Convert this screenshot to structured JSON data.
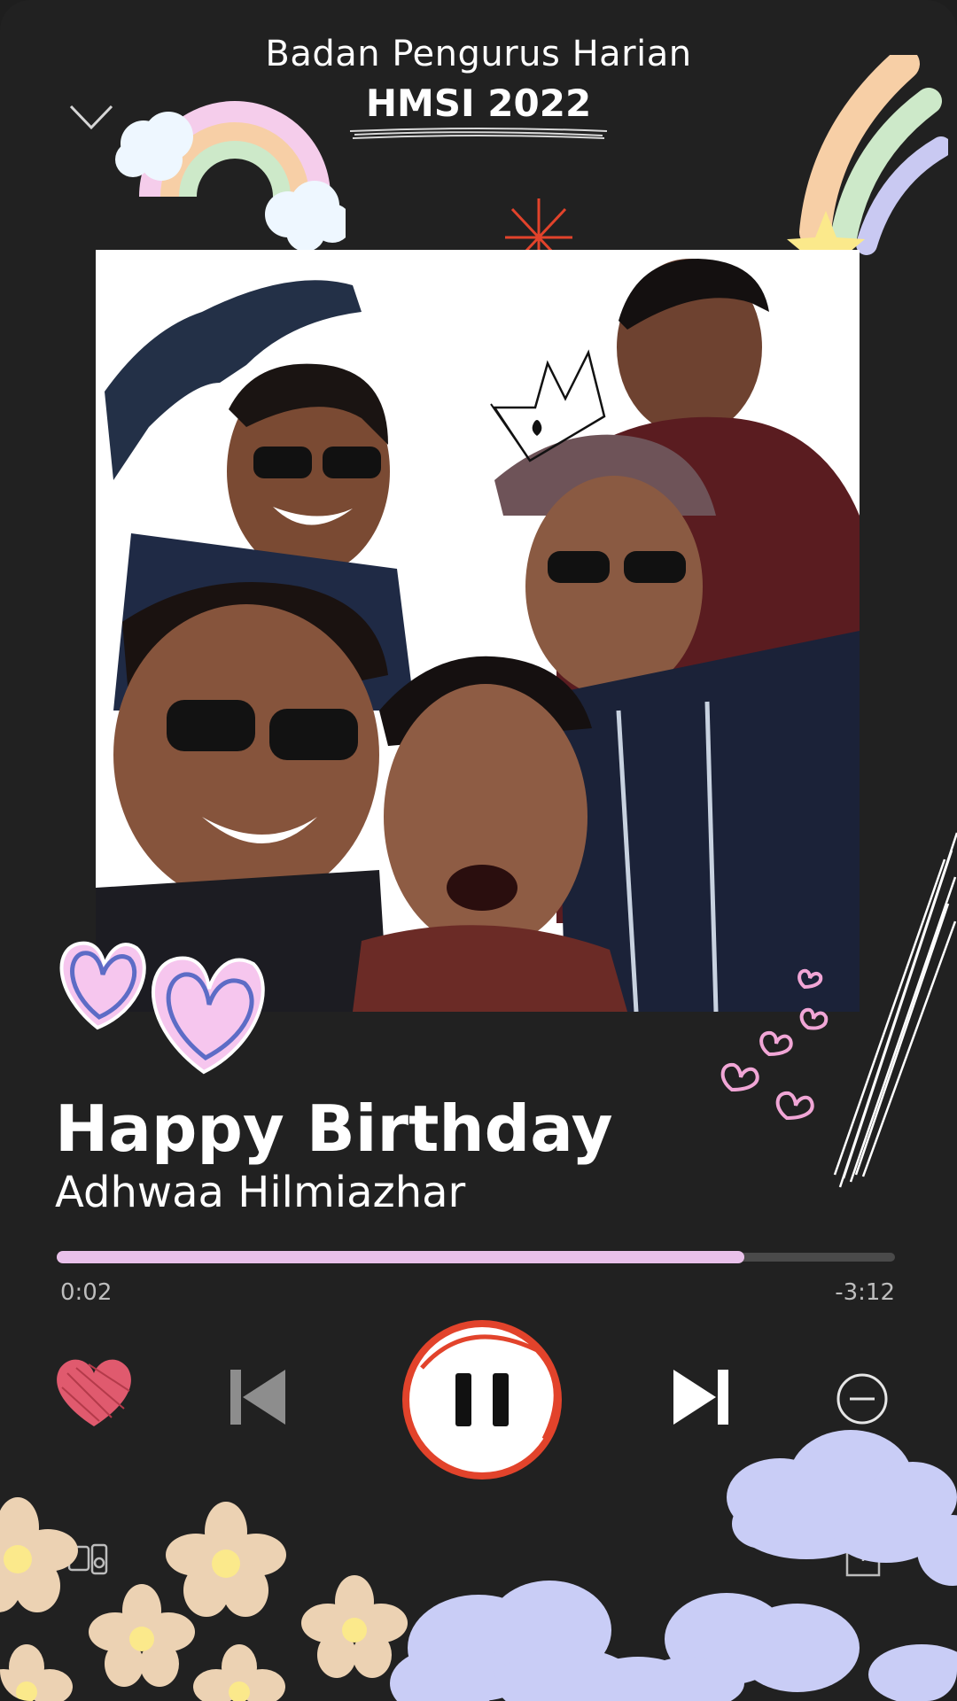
{
  "header": {
    "line1": "Badan Pengurus Harian",
    "line2": "HMSI 2022"
  },
  "track": {
    "title": "Happy Birthday",
    "artist": "Adhwaa Hilmiazhar",
    "elapsed": "0:02",
    "remaining": "-3:12",
    "progress_fraction": 0.82
  },
  "controls": {
    "like_icon": "heart-icon",
    "prev_icon": "skip-previous-icon",
    "play_pause_icon": "pause-icon",
    "next_icon": "skip-next-icon",
    "remove_icon": "minus-circle-icon",
    "devices_icon": "devices-icon",
    "share_icon": "share-icon"
  },
  "colors": {
    "background": "#212121",
    "progress_fill": "#e9c1ea",
    "pause_ring": "#e2432b",
    "heart_like": "#e05a6e"
  }
}
